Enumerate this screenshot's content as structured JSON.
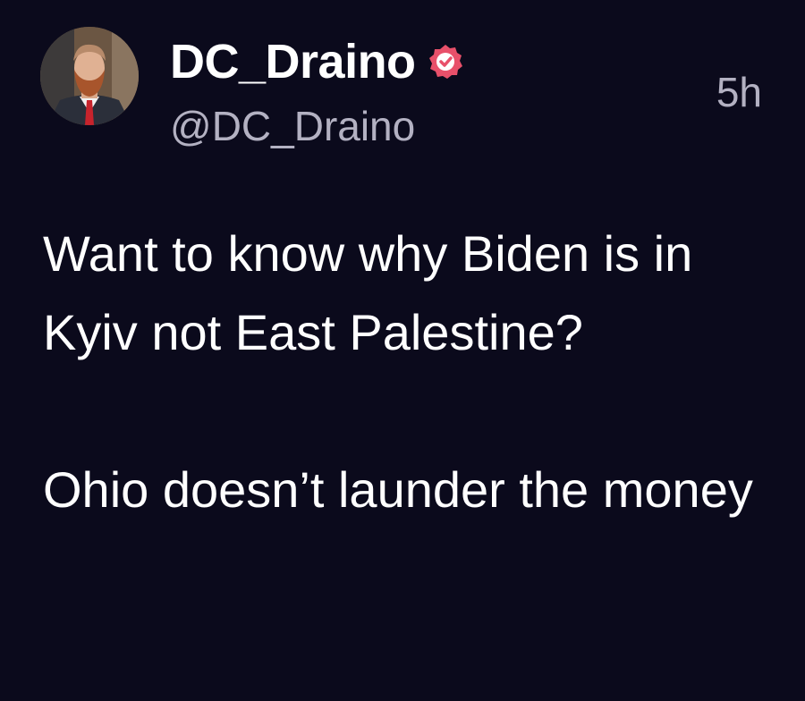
{
  "author": {
    "display_name": "DC_Draino",
    "handle": "@DC_Draino",
    "verified": true,
    "avatar_icon": "profile-photo"
  },
  "post": {
    "timestamp": "5h",
    "paragraphs": [
      "Want to know why Biden is in Kyiv not East Palestine?",
      "Ohio doesn’t launder the money"
    ]
  },
  "colors": {
    "background": "#0b0a1c",
    "text_primary": "#ffffff",
    "text_secondary": "#b3b1c2",
    "verified_badge": "#e8506a"
  }
}
